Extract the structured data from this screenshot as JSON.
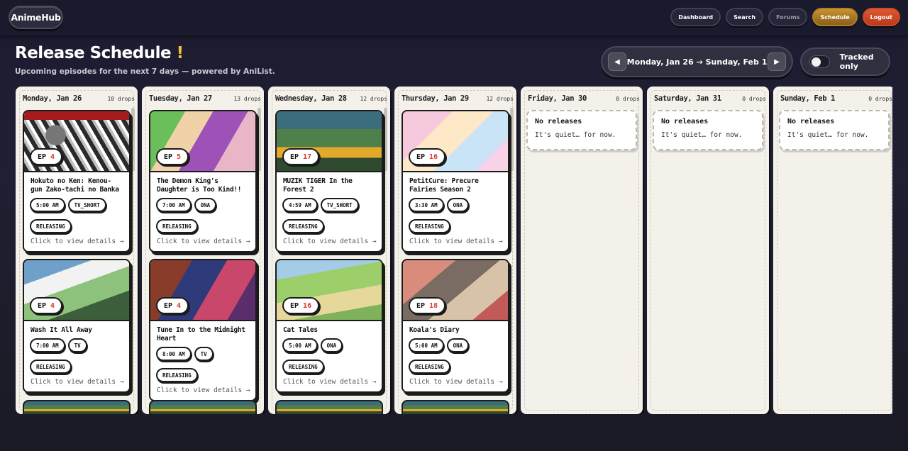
{
  "app": {
    "brand": "AnimeHub"
  },
  "nav": {
    "items": [
      {
        "label": "Dashboard",
        "state": "default"
      },
      {
        "label": "Search",
        "state": "default"
      },
      {
        "label": "Forums",
        "state": "muted"
      },
      {
        "label": "Schedule",
        "state": "active"
      },
      {
        "label": "Logout",
        "state": "danger"
      }
    ]
  },
  "header": {
    "title": "Release Schedule",
    "title_mark": "!",
    "subtitle": "Upcoming episodes for the next 7 days — powered by AniList.",
    "prev_icon": "◀",
    "next_icon": "▶",
    "range": "Monday, Jan 26 → Sunday, Feb 1",
    "tracked_label": "Tracked only",
    "tracked_on": false
  },
  "colors": {
    "accent": "#c8932e",
    "danger": "#e0582f",
    "episode_number": "#e03a2a",
    "column_bg": "#f4f1ea"
  },
  "days": [
    {
      "day": "Monday, Jan 26",
      "count": "10 drops",
      "cards": [
        {
          "ep_label": "EP",
          "ep": "4",
          "title": "Hokuto no Ken: Kenou-gun Zako-tachi no Banka",
          "time": "5:00 AM",
          "format": "TV_SHORT",
          "status": "RELEASING",
          "link": "Click to view details →",
          "img": "img-a"
        },
        {
          "ep_label": "EP",
          "ep": "4",
          "title": "Wash It All Away",
          "time": "7:00 AM",
          "format": "TV",
          "status": "RELEASING",
          "link": "Click to view details →",
          "img": "img-e"
        }
      ]
    },
    {
      "day": "Tuesday, Jan 27",
      "count": "13 drops",
      "cards": [
        {
          "ep_label": "EP",
          "ep": "5",
          "title": "The Demon King's Daughter is Too Kind!!",
          "time": "7:00 AM",
          "format": "ONA",
          "status": "RELEASING",
          "link": "Click to view details →",
          "img": "img-b"
        },
        {
          "ep_label": "EP",
          "ep": "4",
          "title": "Tune In to the Midnight Heart",
          "time": "8:00 AM",
          "format": "TV",
          "status": "RELEASING",
          "link": "Click to view details →",
          "img": "img-f"
        }
      ]
    },
    {
      "day": "Wednesday, Jan 28",
      "count": "12 drops",
      "cards": [
        {
          "ep_label": "EP",
          "ep": "17",
          "title": "MUZIK TIGER In the Forest 2",
          "time": "4:59 AM",
          "format": "TV_SHORT",
          "status": "RELEASING",
          "link": "Click to view details →",
          "img": "img-c"
        },
        {
          "ep_label": "EP",
          "ep": "16",
          "title": "Cat Tales",
          "time": "5:00 AM",
          "format": "ONA",
          "status": "RELEASING",
          "link": "Click to view details →",
          "img": "img-g"
        }
      ]
    },
    {
      "day": "Thursday, Jan 29",
      "count": "12 drops",
      "cards": [
        {
          "ep_label": "EP",
          "ep": "16",
          "title": "PetitCure: Precure Fairies Season 2",
          "time": "3:30 AM",
          "format": "ONA",
          "status": "RELEASING",
          "link": "Click to view details →",
          "img": "img-d"
        },
        {
          "ep_label": "EP",
          "ep": "18",
          "title": "Koala's Diary",
          "time": "5:00 AM",
          "format": "ONA",
          "status": "RELEASING",
          "link": "Click to view details →",
          "img": "img-h"
        }
      ]
    },
    {
      "day": "Friday, Jan 30",
      "count": "0 drops",
      "empty_title": "No releases",
      "empty_sub": "It's quiet… for now.",
      "cards": []
    },
    {
      "day": "Saturday, Jan 31",
      "count": "0 drops",
      "empty_title": "No releases",
      "empty_sub": "It's quiet… for now.",
      "cards": []
    },
    {
      "day": "Sunday, Feb 1",
      "count": "0 drops",
      "empty_title": "No releases",
      "empty_sub": "It's quiet… for now.",
      "cards": []
    }
  ]
}
